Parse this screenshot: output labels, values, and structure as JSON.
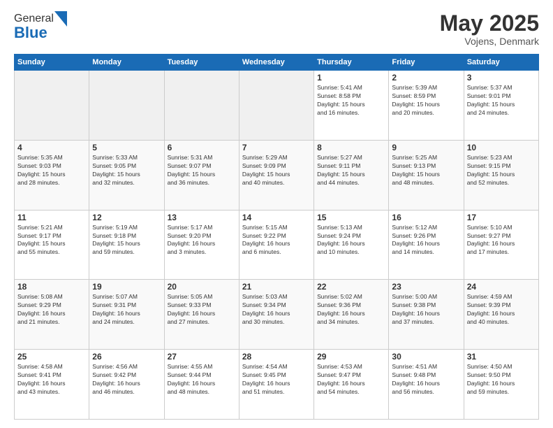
{
  "header": {
    "logo_general": "General",
    "logo_blue": "Blue",
    "title": "May 2025",
    "location": "Vojens, Denmark"
  },
  "days_of_week": [
    "Sunday",
    "Monday",
    "Tuesday",
    "Wednesday",
    "Thursday",
    "Friday",
    "Saturday"
  ],
  "weeks": [
    [
      {
        "day": "",
        "info": ""
      },
      {
        "day": "",
        "info": ""
      },
      {
        "day": "",
        "info": ""
      },
      {
        "day": "",
        "info": ""
      },
      {
        "day": "1",
        "info": "Sunrise: 5:41 AM\nSunset: 8:58 PM\nDaylight: 15 hours\nand 16 minutes."
      },
      {
        "day": "2",
        "info": "Sunrise: 5:39 AM\nSunset: 8:59 PM\nDaylight: 15 hours\nand 20 minutes."
      },
      {
        "day": "3",
        "info": "Sunrise: 5:37 AM\nSunset: 9:01 PM\nDaylight: 15 hours\nand 24 minutes."
      }
    ],
    [
      {
        "day": "4",
        "info": "Sunrise: 5:35 AM\nSunset: 9:03 PM\nDaylight: 15 hours\nand 28 minutes."
      },
      {
        "day": "5",
        "info": "Sunrise: 5:33 AM\nSunset: 9:05 PM\nDaylight: 15 hours\nand 32 minutes."
      },
      {
        "day": "6",
        "info": "Sunrise: 5:31 AM\nSunset: 9:07 PM\nDaylight: 15 hours\nand 36 minutes."
      },
      {
        "day": "7",
        "info": "Sunrise: 5:29 AM\nSunset: 9:09 PM\nDaylight: 15 hours\nand 40 minutes."
      },
      {
        "day": "8",
        "info": "Sunrise: 5:27 AM\nSunset: 9:11 PM\nDaylight: 15 hours\nand 44 minutes."
      },
      {
        "day": "9",
        "info": "Sunrise: 5:25 AM\nSunset: 9:13 PM\nDaylight: 15 hours\nand 48 minutes."
      },
      {
        "day": "10",
        "info": "Sunrise: 5:23 AM\nSunset: 9:15 PM\nDaylight: 15 hours\nand 52 minutes."
      }
    ],
    [
      {
        "day": "11",
        "info": "Sunrise: 5:21 AM\nSunset: 9:17 PM\nDaylight: 15 hours\nand 55 minutes."
      },
      {
        "day": "12",
        "info": "Sunrise: 5:19 AM\nSunset: 9:18 PM\nDaylight: 15 hours\nand 59 minutes."
      },
      {
        "day": "13",
        "info": "Sunrise: 5:17 AM\nSunset: 9:20 PM\nDaylight: 16 hours\nand 3 minutes."
      },
      {
        "day": "14",
        "info": "Sunrise: 5:15 AM\nSunset: 9:22 PM\nDaylight: 16 hours\nand 6 minutes."
      },
      {
        "day": "15",
        "info": "Sunrise: 5:13 AM\nSunset: 9:24 PM\nDaylight: 16 hours\nand 10 minutes."
      },
      {
        "day": "16",
        "info": "Sunrise: 5:12 AM\nSunset: 9:26 PM\nDaylight: 16 hours\nand 14 minutes."
      },
      {
        "day": "17",
        "info": "Sunrise: 5:10 AM\nSunset: 9:27 PM\nDaylight: 16 hours\nand 17 minutes."
      }
    ],
    [
      {
        "day": "18",
        "info": "Sunrise: 5:08 AM\nSunset: 9:29 PM\nDaylight: 16 hours\nand 21 minutes."
      },
      {
        "day": "19",
        "info": "Sunrise: 5:07 AM\nSunset: 9:31 PM\nDaylight: 16 hours\nand 24 minutes."
      },
      {
        "day": "20",
        "info": "Sunrise: 5:05 AM\nSunset: 9:33 PM\nDaylight: 16 hours\nand 27 minutes."
      },
      {
        "day": "21",
        "info": "Sunrise: 5:03 AM\nSunset: 9:34 PM\nDaylight: 16 hours\nand 30 minutes."
      },
      {
        "day": "22",
        "info": "Sunrise: 5:02 AM\nSunset: 9:36 PM\nDaylight: 16 hours\nand 34 minutes."
      },
      {
        "day": "23",
        "info": "Sunrise: 5:00 AM\nSunset: 9:38 PM\nDaylight: 16 hours\nand 37 minutes."
      },
      {
        "day": "24",
        "info": "Sunrise: 4:59 AM\nSunset: 9:39 PM\nDaylight: 16 hours\nand 40 minutes."
      }
    ],
    [
      {
        "day": "25",
        "info": "Sunrise: 4:58 AM\nSunset: 9:41 PM\nDaylight: 16 hours\nand 43 minutes."
      },
      {
        "day": "26",
        "info": "Sunrise: 4:56 AM\nSunset: 9:42 PM\nDaylight: 16 hours\nand 46 minutes."
      },
      {
        "day": "27",
        "info": "Sunrise: 4:55 AM\nSunset: 9:44 PM\nDaylight: 16 hours\nand 48 minutes."
      },
      {
        "day": "28",
        "info": "Sunrise: 4:54 AM\nSunset: 9:45 PM\nDaylight: 16 hours\nand 51 minutes."
      },
      {
        "day": "29",
        "info": "Sunrise: 4:53 AM\nSunset: 9:47 PM\nDaylight: 16 hours\nand 54 minutes."
      },
      {
        "day": "30",
        "info": "Sunrise: 4:51 AM\nSunset: 9:48 PM\nDaylight: 16 hours\nand 56 minutes."
      },
      {
        "day": "31",
        "info": "Sunrise: 4:50 AM\nSunset: 9:50 PM\nDaylight: 16 hours\nand 59 minutes."
      }
    ]
  ]
}
